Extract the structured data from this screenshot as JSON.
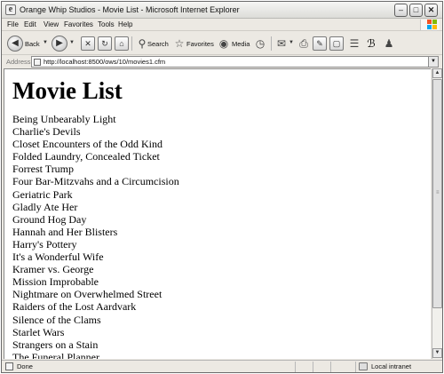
{
  "window": {
    "title": "Orange Whip Studios - Movie List - Microsoft Internet Explorer",
    "title_icon": "ie-page-icon"
  },
  "menu": [
    "File",
    "Edit",
    "View",
    "Favorites",
    "Tools",
    "Help"
  ],
  "toolbar": {
    "back_label": "Back",
    "search_label": "Search",
    "favorites_label": "Favorites",
    "media_label": "Media"
  },
  "address": {
    "label": "Address",
    "url": "http://localhost:8500/ows/10/movies1.cfm"
  },
  "page": {
    "heading": "Movie List",
    "movies": [
      "Being Unbearably Light",
      "Charlie's Devils",
      "Closet Encounters of the Odd Kind",
      "Folded Laundry, Concealed Ticket",
      "Forrest Trump",
      "Four Bar-Mitzvahs and a Circumcision",
      "Geriatric Park",
      "Gladly Ate Her",
      "Ground Hog Day",
      "Hannah and Her Blisters",
      "Harry's Pottery",
      "It's a Wonderful Wife",
      "Kramer vs. George",
      "Mission Improbable",
      "Nightmare on Overwhelmed Street",
      "Raiders of the Lost Aardvark",
      "Silence of the Clams",
      "Starlet Wars",
      "Strangers on a Stain",
      "The Funeral Planner"
    ]
  },
  "status": {
    "text": "Done",
    "zone": "Local intranet"
  }
}
